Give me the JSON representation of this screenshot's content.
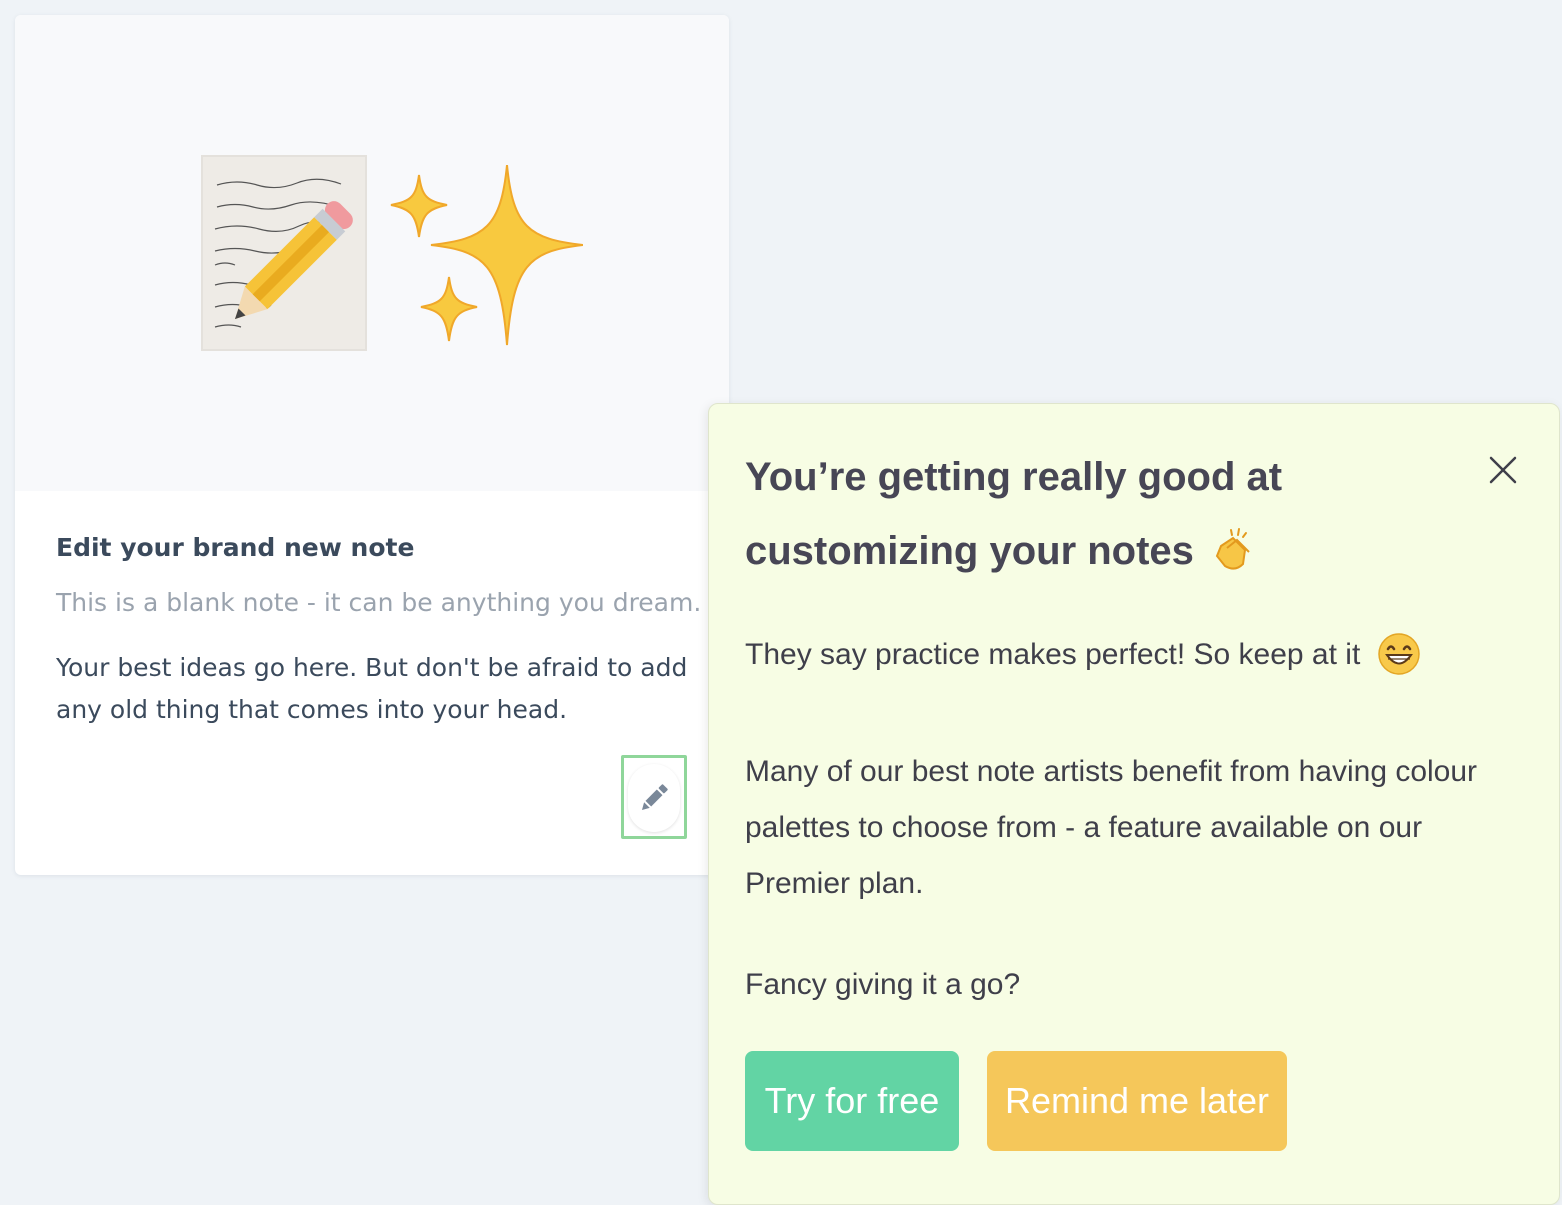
{
  "note": {
    "title": "Edit your brand new note",
    "subtitle": "This is a blank note - it can be anything you dream.",
    "body": "Your best ideas go here. But don't be afraid to add any old thing that comes into your head.",
    "media_icons": [
      "memo-icon",
      "sparkles-icon"
    ],
    "edit_icon": "pencil-icon"
  },
  "popup": {
    "title": "You’re getting really good at customizing your notes",
    "title_icon": "clapping-hands-icon",
    "paragraph_1": "They say practice makes perfect! So keep at it",
    "paragraph_1_icon": "grinning-face-icon",
    "paragraph_2": "Many of our best note artists benefit from having colour palettes to choose from - a feature available on our Premier plan.",
    "paragraph_3": "Fancy giving it a go?",
    "close_icon": "close-icon",
    "primary_button": "Try for free",
    "secondary_button": "Remind me later"
  },
  "colors": {
    "page_background": "#eff3f7",
    "popup_background": "#f7fde4",
    "primary_button": "#62d4a4",
    "secondary_button": "#f5c75a",
    "highlight_border": "#8fd69a"
  }
}
